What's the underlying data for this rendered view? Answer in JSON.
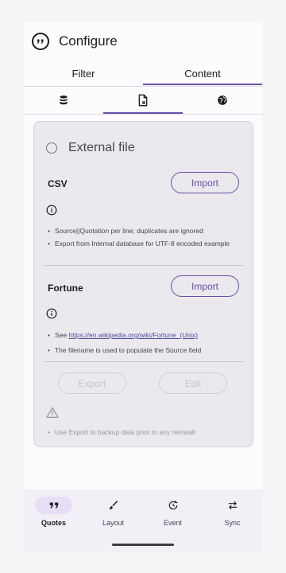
{
  "header": {
    "title": "Configure",
    "icon": "quote-bubble-icon"
  },
  "tabs": [
    {
      "label": "Filter",
      "active": false
    },
    {
      "label": "Content",
      "active": true
    }
  ],
  "subtabs": [
    {
      "icon": "database-icon",
      "active": false
    },
    {
      "icon": "file-icon",
      "active": true
    },
    {
      "icon": "globe-icon",
      "active": false
    }
  ],
  "external_file": {
    "label": "External file",
    "selected": false
  },
  "csv": {
    "title": "CSV",
    "import_label": "Import",
    "bullets": [
      "Source||Quotation per line; duplicates are ignored",
      "Export from Internal database for UTF-8 encoded example"
    ]
  },
  "fortune": {
    "title": "Fortune",
    "import_label": "Import",
    "see_prefix": "See ",
    "link": "https://en.wikipedia.org/wiki/Fortune_(Unix)",
    "bullet2": "The filename is used to populate the Source field"
  },
  "actions": {
    "export_label": "Export",
    "edit_label": "Edit"
  },
  "warning": {
    "text": "Use Export to backup data prior to any reinstall"
  },
  "nav": [
    {
      "label": "Quotes",
      "icon": "quotes-icon",
      "active": true
    },
    {
      "label": "Layout",
      "icon": "brush-icon",
      "active": false
    },
    {
      "label": "Event",
      "icon": "event-icon",
      "active": false
    },
    {
      "label": "Sync",
      "icon": "sync-icon",
      "active": false
    }
  ],
  "colors": {
    "accent": "#6750a4",
    "card": "#ebe8ee",
    "nav_bg": "#f3eff6",
    "pill": "#e8def8"
  }
}
